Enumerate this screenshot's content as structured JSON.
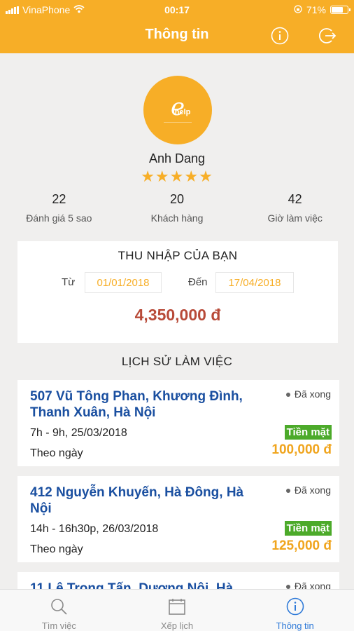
{
  "status_bar": {
    "carrier": "VinaPhone",
    "time": "00:17",
    "battery": "71%"
  },
  "navbar": {
    "title": "Thông tin",
    "info_icon": "info-icon",
    "logout_icon": "logout-icon"
  },
  "profile": {
    "avatar_logo": "ehelp",
    "name": "Anh Dang",
    "rating_stars": "★★★★★",
    "stats": [
      {
        "value": "22",
        "label": "Đánh giá 5 sao"
      },
      {
        "value": "20",
        "label": "Khách hàng"
      },
      {
        "value": "42",
        "label": "Giờ làm việc"
      }
    ]
  },
  "income": {
    "title": "THU NHẬP CỦA BẠN",
    "from_label": "Từ",
    "from_date": "01/01/2018",
    "to_label": "Đến",
    "to_date": "17/04/2018",
    "amount": "4,350,000 đ"
  },
  "history": {
    "title": "LỊCH SỬ LÀM VIỆC",
    "jobs": [
      {
        "address": "507 Vũ Tông Phan, Khương Đình, Thanh Xuân, Hà Nội",
        "status": "Đã xong",
        "time": "7h - 9h, 25/03/2018",
        "payment": "Tiền mặt",
        "type": "Theo ngày",
        "price": "100,000 đ"
      },
      {
        "address": "412 Nguyễn Khuyến, Hà Đông, Hà Nội",
        "status": "Đã xong",
        "time": "14h - 16h30p, 26/03/2018",
        "payment": "Tiền mặt",
        "type": "Theo ngày",
        "price": "125,000 đ"
      },
      {
        "address": "11 Lê Trọng Tấn, Dương Nội, Hà",
        "status": "Đã xong",
        "time": "",
        "payment": "",
        "type": "",
        "price": ""
      }
    ]
  },
  "tabbar": {
    "tabs": [
      {
        "label": "Tìm việc",
        "icon": "search-icon"
      },
      {
        "label": "Xếp lịch",
        "icon": "calendar-icon"
      },
      {
        "label": "Thông tin",
        "icon": "info-icon"
      }
    ],
    "active_index": 2
  },
  "colors": {
    "primary": "#f7ae27",
    "link_blue": "#1a4fa0",
    "income_red": "#b84a38",
    "cash_green": "#4caa2a",
    "active_tab": "#2f7ad8"
  }
}
